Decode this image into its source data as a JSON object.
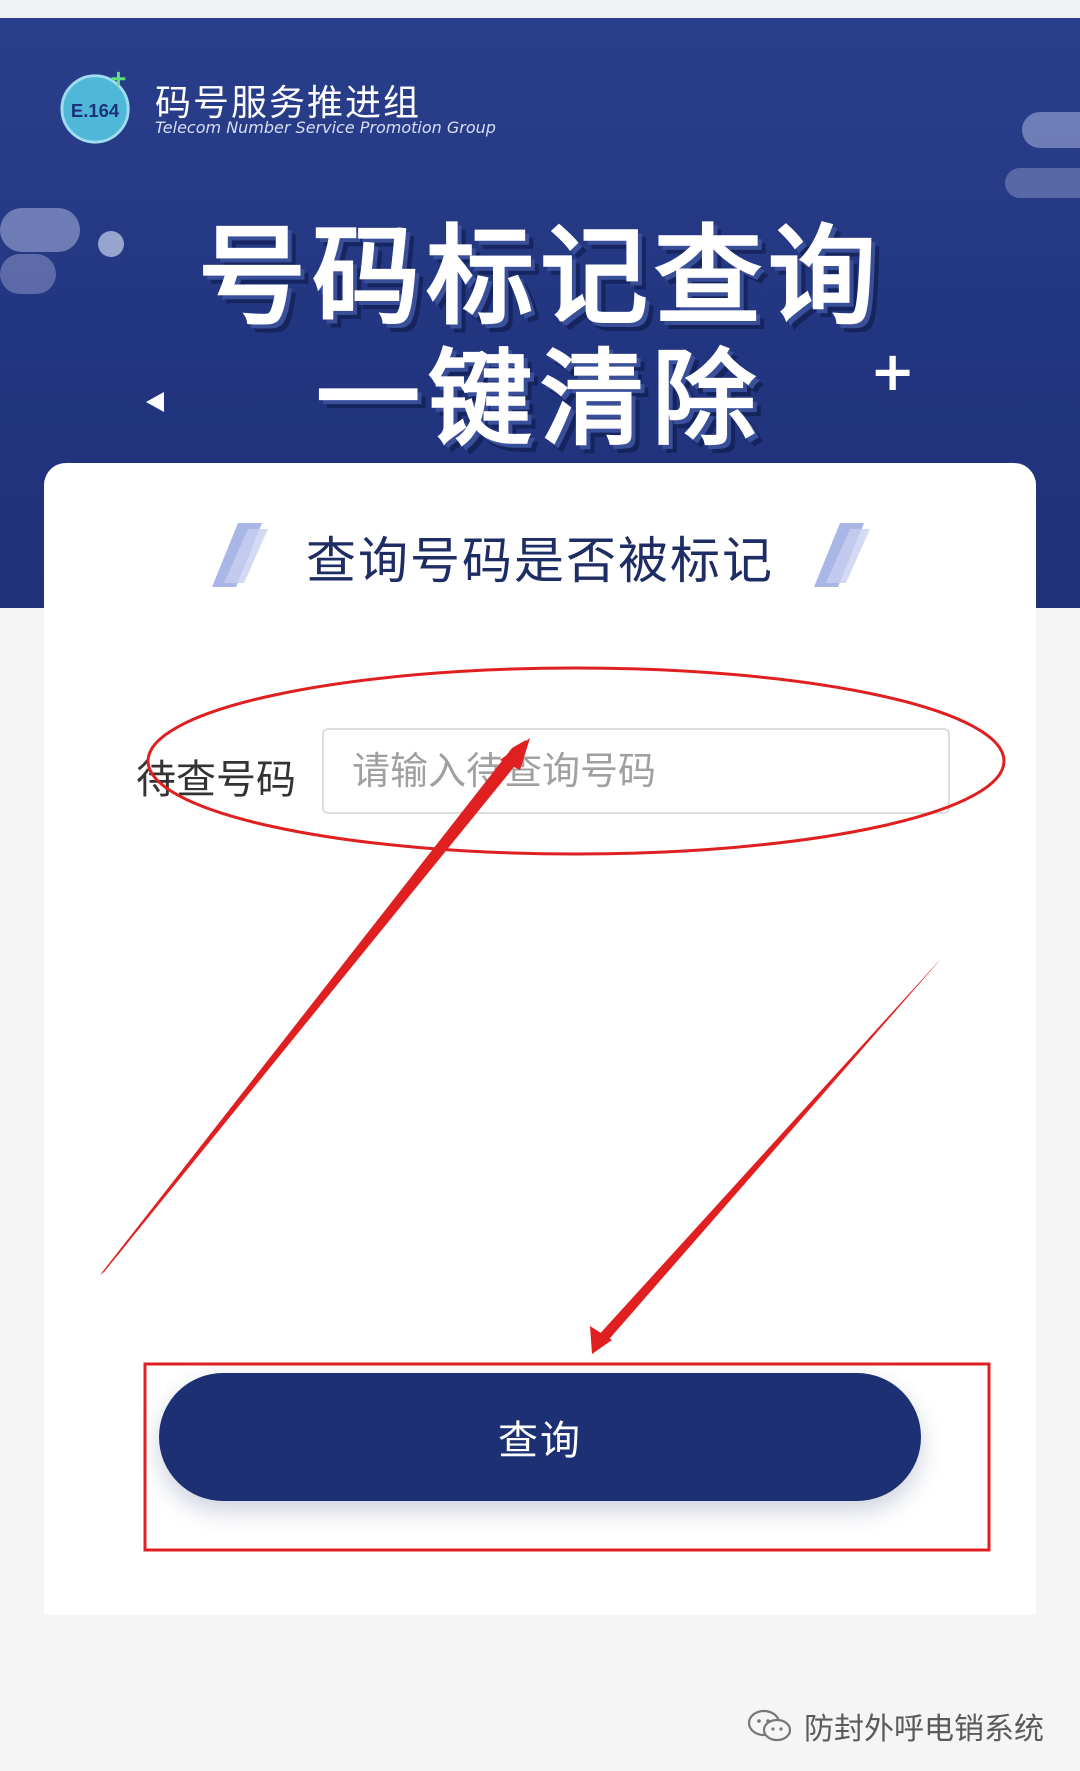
{
  "header": {
    "logo_badge": "E.164",
    "org_name_cn": "码号服务推进组",
    "org_name_en": "Telecom Number Service  Promotion Group",
    "hero_line1": "号码标记查询",
    "hero_line2": "一键清除",
    "plus_glyph": "+"
  },
  "card": {
    "title": "查询号码是否被标记",
    "form": {
      "label": "待查号码",
      "placeholder": "请输入待查询号码",
      "value": ""
    },
    "query_button": "查询"
  },
  "watermark": {
    "text": "防封外呼电销系统",
    "icon": "wechat-icon"
  },
  "colors": {
    "banner": "#223580",
    "button": "#1d3073",
    "title_text": "#1e2d63",
    "annotation": "#e02020"
  }
}
